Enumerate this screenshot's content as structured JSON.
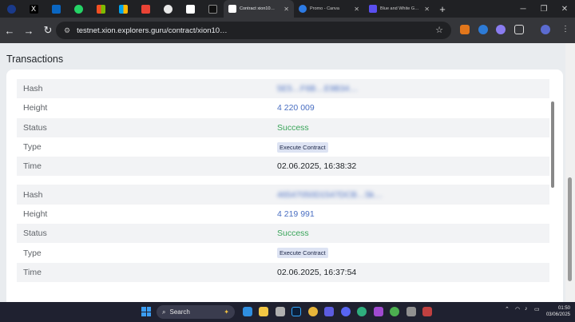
{
  "browser": {
    "tabs": [
      {
        "title": "Contract xion10…",
        "active": true,
        "favicon_color": "#ffffff"
      },
      {
        "title": "Promo - Canva",
        "active": false,
        "favicon_color": "#2c7be5"
      },
      {
        "title": "Blue and White G…",
        "active": false,
        "favicon_color": "#5a4ff0"
      }
    ],
    "url": "testnet.xion.explorers.guru/contract/xion10…"
  },
  "page": {
    "section_title": "Transactions",
    "transactions": [
      {
        "rows": [
          {
            "label": "Hash",
            "value": "5E5…F6B…E9B34…",
            "style": "link blur"
          },
          {
            "label": "Height",
            "value": "4 220 009",
            "style": "link"
          },
          {
            "label": "Status",
            "value": "Success",
            "style": "success"
          },
          {
            "label": "Type",
            "value": "Execute Contract",
            "style": "badge"
          },
          {
            "label": "Time",
            "value": "02.06.2025, 16:38:32",
            "style": ""
          }
        ]
      },
      {
        "rows": [
          {
            "label": "Hash",
            "value": "46547050D1547DCB…5k…",
            "style": "link blur"
          },
          {
            "label": "Height",
            "value": "4 219 991",
            "style": "link"
          },
          {
            "label": "Status",
            "value": "Success",
            "style": "success"
          },
          {
            "label": "Type",
            "value": "Execute Contract",
            "style": "badge"
          },
          {
            "label": "Time",
            "value": "02.06.2025, 16:37:54",
            "style": ""
          }
        ]
      }
    ]
  },
  "taskbar": {
    "search_label": "Search",
    "time": "01:50",
    "date": "03/06/2025"
  }
}
